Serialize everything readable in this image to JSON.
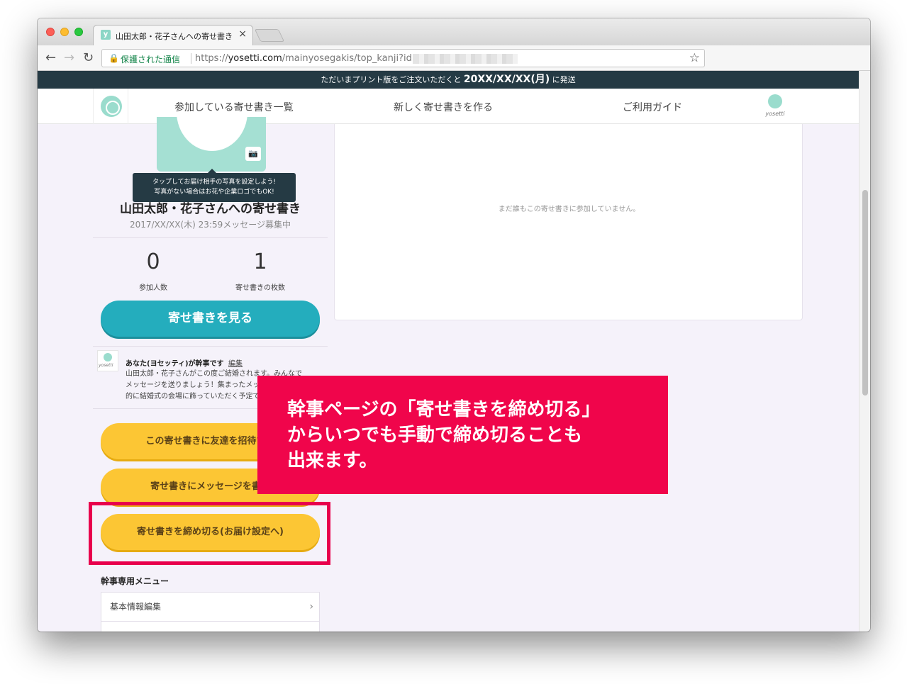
{
  "browser": {
    "tab_title": "山田太郎・花子さんへの寄せ書き",
    "tab_favicon_letter": "y",
    "secure_label": "保護された通信",
    "url_scheme": "https://",
    "url_host": "yosetti.com",
    "url_path": "/mainyosegakis/top_kanji?id="
  },
  "banner": {
    "prefix": "ただいまプリント版をご注文いただくと",
    "date": "20XX/XX/XX(月)",
    "suffix": "に発送"
  },
  "site_nav": {
    "items": [
      {
        "label": "参加している寄せ書き一覧"
      },
      {
        "label": "新しく寄せ書きを作る"
      },
      {
        "label": "ご利用ガイド"
      }
    ],
    "user_logo_text": "yosetti"
  },
  "card": {
    "photo_tooltip_line1": "タップしてお届け相手の写真を設定しよう!",
    "photo_tooltip_line2": "写真がない場合はお花や企業ロゴでもOK!",
    "title": "山田太郎・花子さんへの寄せ書き",
    "deadline": "2017/XX/XX(木) 23:59メッセージ募集中",
    "stats": [
      {
        "value": "0",
        "label": "参加人数"
      },
      {
        "value": "1",
        "label": "寄せ書きの枚数"
      }
    ],
    "view_button": "寄せ書きを見る"
  },
  "organizer": {
    "avatar_text": "yosetti",
    "name": "あなた(ヨセッティ)が幹事です",
    "edit_link": "編集",
    "message_lines": [
      "山田太郎・花子さんがこの度ご結婚されます。みんなで",
      "メッセージを送りましょう！集まったメッセージは最終",
      "的に結婚式の会場に飾っていただく予定です。"
    ]
  },
  "actions": {
    "invite_button": "この寄せ書きに友達を招待する",
    "write_button": "寄せ書きにメッセージを書く",
    "close_button": "寄せ書きを締め切る(お届け設定へ)"
  },
  "organizer_menu": {
    "heading": "幹事専用メニュー",
    "items": [
      {
        "label": "基本情報編集"
      }
    ]
  },
  "participants_panel": {
    "empty_message": "まだ誰もこの寄せ書きに参加していません。"
  },
  "callout": {
    "lines": [
      "幹事ページの「寄せ書きを締め切る」",
      "からいつでも手動で締め切ることも",
      "出来ます。"
    ],
    "color": "#f0054b"
  },
  "colors": {
    "teal_button": "#24adbd",
    "yellow_button": "#fcc634",
    "highlight": "#e8004c",
    "banner": "#253a44"
  }
}
